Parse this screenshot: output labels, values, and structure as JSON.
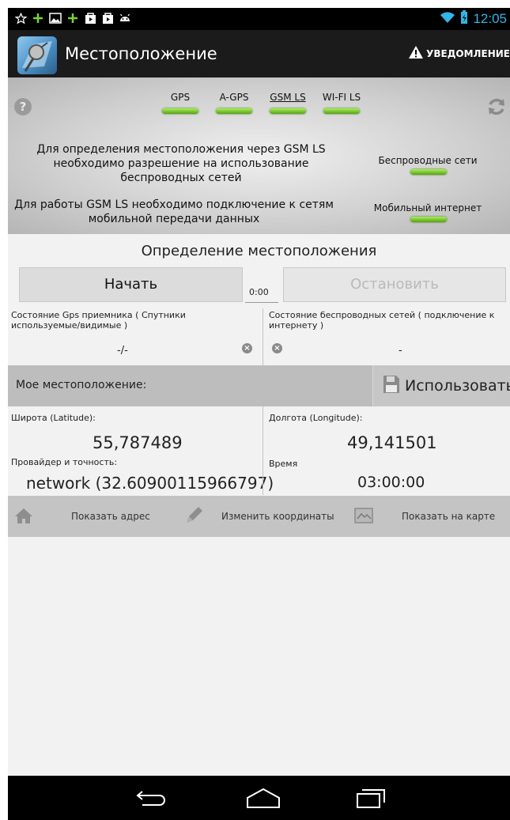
{
  "status_bar": {
    "time": "12:05",
    "left_icons": [
      "star-icon",
      "plus-icon",
      "image-icon",
      "plus-icon",
      "bag-icon",
      "bag-icon",
      "android-icon"
    ],
    "right_icons": [
      "wifi-icon",
      "battery-icon"
    ]
  },
  "action_bar": {
    "title": "Местоположение",
    "notification_label": "УВЕДОМЛЕНИЕ"
  },
  "modes": [
    {
      "label": "GPS",
      "selected": false,
      "status_color": "#7ad32e"
    },
    {
      "label": "A-GPS",
      "selected": false,
      "status_color": "#7ad32e"
    },
    {
      "label": "GSM LS",
      "selected": true,
      "status_color": "#7ad32e"
    },
    {
      "label": "WI-FI LS",
      "selected": false,
      "status_color": "#7ad32e"
    }
  ],
  "messages": {
    "gsm_permission": "Для определения местоположения через GSM LS необходимо разрешение на использование беспроводных сетей",
    "gsm_mobile": "Для работы GSM LS необходимо подключение к сетям мобильной передачи данных",
    "wireless_label": "Беспроводные сети",
    "mobile_label": "Мобильный интернет"
  },
  "location_section": {
    "title": "Определение местоположения",
    "start_label": "Начать",
    "stop_label": "Остановить",
    "timer": "0:00"
  },
  "status": {
    "gps_label": "Состояние Gps приемника ( Спутники используемые/видимые )",
    "gps_value": "-/-",
    "wireless_label": "Состояние беспроводных сетей ( подключение к интернету )",
    "wireless_value": "-"
  },
  "my_location": {
    "label": "Мое местоположение:",
    "use_label": "Использовать"
  },
  "coords": {
    "lat_label": "Широта (Latitude):",
    "lat_value": "55,787489",
    "lon_label": "Долгота (Longitude):",
    "lon_value": "49,141501",
    "provider_label": "Провайдер и точность:",
    "provider_value": "network (32.60900115966797)",
    "time_label": "Время",
    "time_value": "03:00:00"
  },
  "actions": {
    "show_address": "Показать адрес",
    "edit_coords": "Изменить координаты",
    "show_map": "Показать на карте"
  },
  "colors": {
    "accent_time": "#33b5e5",
    "led_green": "#7ad32e"
  }
}
